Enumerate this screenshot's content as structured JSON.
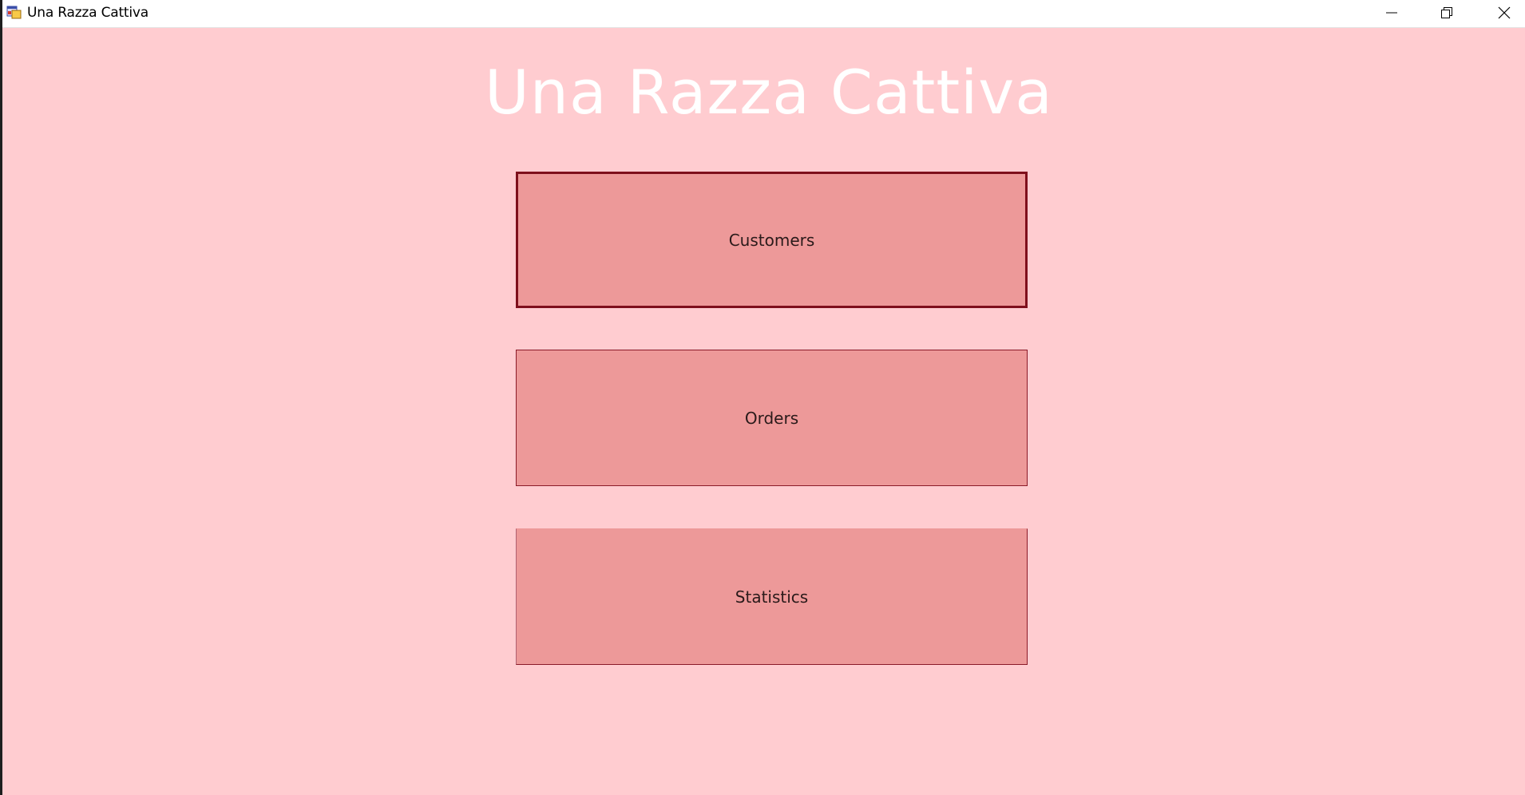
{
  "window": {
    "title": "Una Razza Cattiva",
    "controls": {
      "minimize_icon": "minimize-icon",
      "maximize_icon": "restore-icon",
      "close_icon": "close-icon"
    }
  },
  "main": {
    "heading": "Una Razza Cattiva",
    "buttons": [
      {
        "label": "Customers",
        "focused": true
      },
      {
        "label": "Orders",
        "focused": false
      },
      {
        "label": "Statistics",
        "focused": false
      }
    ]
  },
  "colors": {
    "background": "#ffccd0",
    "button_fill": "#ed9999",
    "button_border": "#8a1a28",
    "heading": "#ffffff"
  }
}
